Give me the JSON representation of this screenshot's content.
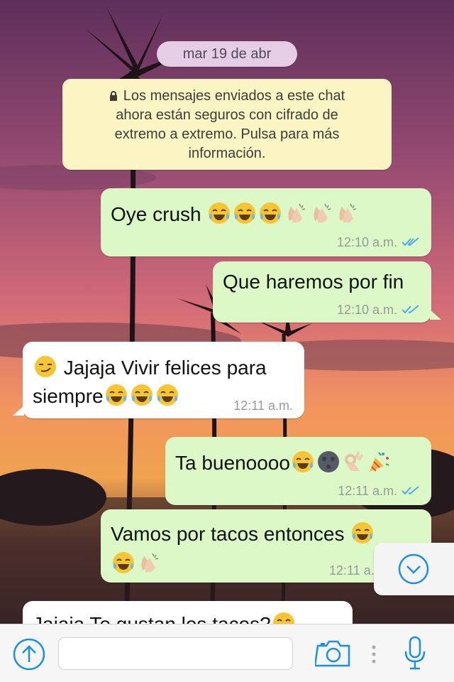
{
  "colors": {
    "outgoing_bubble": "#dcf8c6",
    "incoming_bubble": "#ffffff",
    "accent": "#1a8fe3",
    "system_bubble": "#fbf5c3",
    "date_pill": "#e6cde6"
  },
  "date_label": "mar 19 de abr",
  "system_message": {
    "line1": "Los mensajes enviados a este chat",
    "line2": "ahora están seguros con cifrado de",
    "line3": "extremo a extremo. Pulsa para más",
    "line4": "información.",
    "icon": "lock-icon"
  },
  "messages": [
    {
      "direction": "out",
      "text": "Oye crush",
      "emojis": [
        "joy",
        "joy",
        "joy",
        "clap",
        "clap",
        "clap"
      ],
      "time": "12:10 a.m.",
      "status": "read"
    },
    {
      "direction": "out",
      "text": "Que haremos por fin",
      "time": "12:10 a.m.",
      "status": "read"
    },
    {
      "direction": "in",
      "line1": "Jajaja Vivir felices para",
      "line2": "siempre",
      "emojis_lead": [
        "smirk"
      ],
      "emojis": [
        "joy",
        "joy",
        "joy"
      ],
      "time": "12:11 a.m."
    },
    {
      "direction": "out",
      "text": "Ta buenoooo",
      "emojis": [
        "joy",
        "new-moon-face",
        "ok-hand",
        "party-popper"
      ],
      "time": "12:11 a.m.",
      "status": "read"
    },
    {
      "direction": "out",
      "line1": "Vamos por tacos entonces",
      "emojis": [
        "joy",
        "joy",
        "clap"
      ],
      "time": "12:11 a.m.",
      "status": "read"
    },
    {
      "direction": "in",
      "partial_text": "Jajaja Te gustan los tacos?",
      "emojis": [
        "joy"
      ]
    }
  ],
  "toolbar": {
    "icons": [
      "upload-icon",
      "camera-icon",
      "more-dots-icon",
      "microphone-icon"
    ],
    "input_value": "",
    "input_placeholder": ""
  },
  "scroll_button_icon": "chevron-down-icon"
}
